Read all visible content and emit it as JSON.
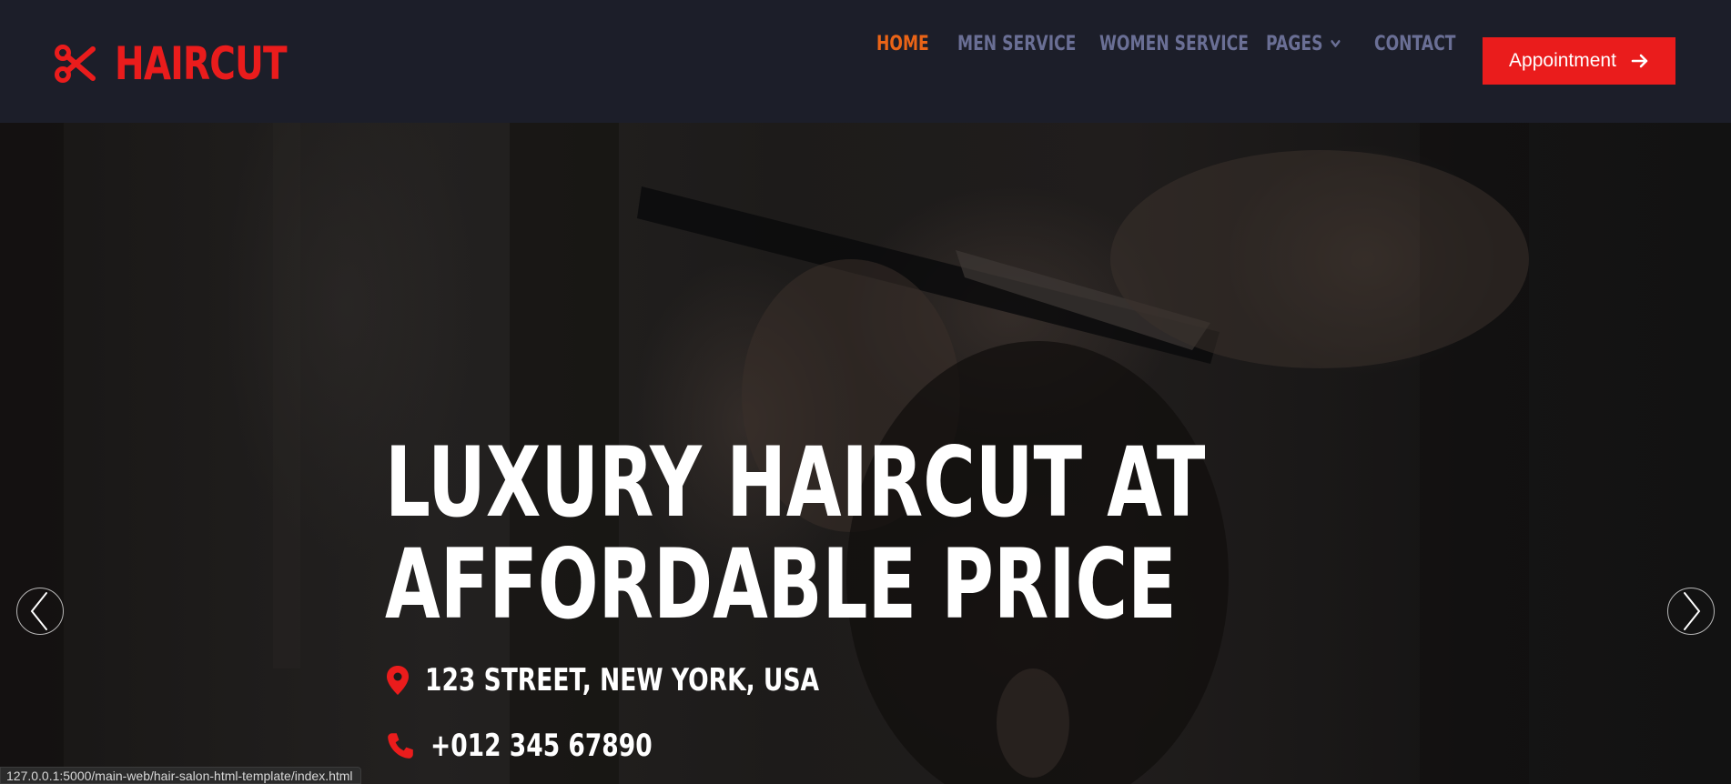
{
  "brand": {
    "name": "HAIRCUT",
    "icon": "scissors-icon",
    "color": "#ea1c1c"
  },
  "nav": {
    "items": [
      {
        "label": "HOME",
        "active": true
      },
      {
        "label": "MEN SERVICE",
        "active": false
      },
      {
        "label": "WOMEN SERVICE",
        "active": false
      },
      {
        "label": "PAGES",
        "active": false,
        "dropdown": true
      },
      {
        "label": "CONTACT",
        "active": false
      }
    ],
    "active_color": "#ea6417",
    "inactive_color": "#6a6f95"
  },
  "appointment_button": {
    "label": "Appointment",
    "icon": "arrow-right-icon"
  },
  "hero": {
    "title_line1": "LUXURY HAIRCUT AT",
    "title_line2": "AFFORDABLE PRICE",
    "address": "123 STREET, NEW YORK, USA",
    "address_icon": "map-pin-icon",
    "phone": "+012 345 67890",
    "phone_icon": "phone-icon",
    "prev_icon": "chevron-left-icon",
    "next_icon": "chevron-right-icon"
  },
  "status_url": "127.0.0.1:5000/main-web/hair-salon-html-template/index.html"
}
